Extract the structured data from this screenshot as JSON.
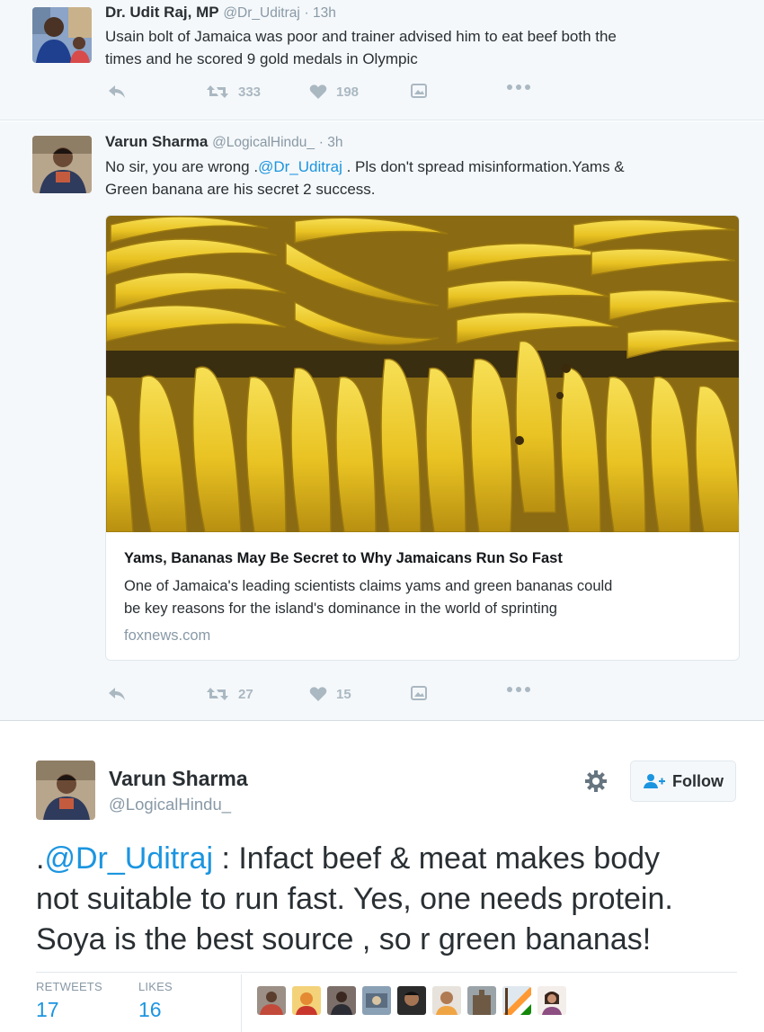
{
  "tweet1": {
    "name": "Dr. Udit Raj, MP",
    "handle": "@Dr_Uditraj",
    "time": "· 13h",
    "text_line1": "Usain bolt of Jamaica was poor and trainer advised him  to eat beef both the",
    "text_line2": "times and he scored 9 gold medals in Olympic",
    "retweets": "333",
    "likes": "198"
  },
  "tweet2": {
    "name": "Varun Sharma",
    "handle": "@LogicalHindu_",
    "time": "· 3h",
    "text_pre": "No sir, you are wrong .",
    "mention": "@Dr_Uditraj",
    "text_post": " . Pls don't spread misinformation.Yams &",
    "text_line2": "Green banana are his secret 2 success.",
    "retweets": "27",
    "likes": "15",
    "card": {
      "title": "Yams, Bananas May Be Secret to Why Jamaicans Run So Fast",
      "desc_line1": "One of Jamaica's leading scientists claims yams and green bananas could",
      "desc_line2": "be key reasons for the island's dominance in the world of sprinting",
      "domain": "foxnews.com"
    }
  },
  "main": {
    "name": "Varun Sharma",
    "handle": "@LogicalHindu_",
    "follow_label": "Follow",
    "text_pre": ".",
    "mention": "@Dr_Uditraj",
    "text_line1_rest": " : Infact beef & meat makes body",
    "text_line2": "not suitable to run fast. Yes, one needs protein.",
    "text_line3": "Soya is the best source , so r green bananas!",
    "retweets_label": "RETWEETS",
    "retweets_value": "17",
    "likes_label": "LIKES",
    "likes_value": "16"
  },
  "colors": {
    "link": "#1b95e0",
    "muted": "#8899a6",
    "icon": "#aab8c2",
    "text": "#292f33",
    "banana": "#f2cf2a"
  },
  "icons": [
    "reply-icon",
    "retweet-icon",
    "like-icon",
    "media-icon",
    "more-icon",
    "gear-icon",
    "follow-user-icon"
  ]
}
